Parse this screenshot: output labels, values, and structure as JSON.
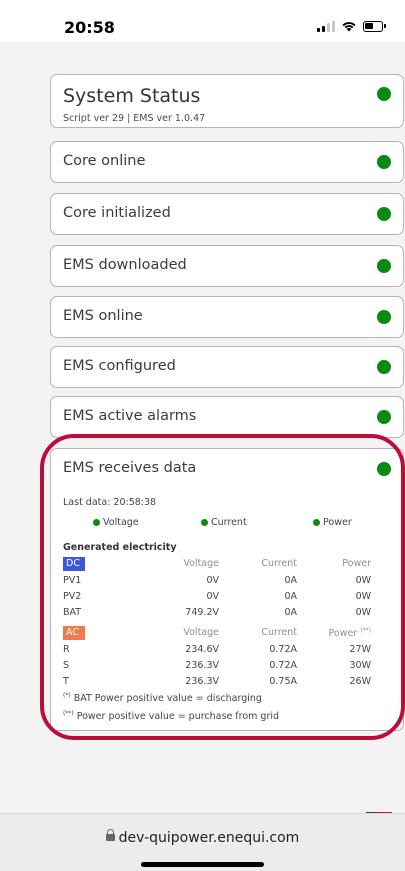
{
  "status_bar": {
    "time": "20:58"
  },
  "system_status": {
    "title": "System Status",
    "subtitle": "Script ver 29 | EMS ver 1.0.47"
  },
  "checks": [
    {
      "label": "Core online"
    },
    {
      "label": "Core initialized"
    },
    {
      "label": "EMS downloaded"
    },
    {
      "label": "EMS online"
    },
    {
      "label": "EMS configured"
    },
    {
      "label": "EMS active alarms"
    }
  ],
  "receives": {
    "title": "EMS receives data",
    "last_data": "Last data: 20:58:38",
    "legend": {
      "voltage": "Voltage",
      "current": "Current",
      "power": "Power"
    },
    "generated_title": "Generated electricity",
    "dc": {
      "tag": "DC",
      "headers": {
        "voltage": "Voltage",
        "current": "Current",
        "power": "Power"
      },
      "rows": [
        {
          "name": "PV1",
          "voltage": "0V",
          "current": "0A",
          "power": "0W"
        },
        {
          "name": "PV2",
          "voltage": "0V",
          "current": "0A",
          "power": "0W"
        },
        {
          "name": "BAT",
          "voltage": "749.2V",
          "current": "0A",
          "power": "0W"
        }
      ]
    },
    "ac": {
      "tag": "AC",
      "headers": {
        "voltage": "Voltage",
        "current": "Current",
        "power": "Power"
      },
      "power_marker": "(**)",
      "rows": [
        {
          "name": "R",
          "voltage": "234.6V",
          "current": "0.72A",
          "power": "27W"
        },
        {
          "name": "S",
          "voltage": "236.3V",
          "current": "0.72A",
          "power": "30W"
        },
        {
          "name": "T",
          "voltage": "236.3V",
          "current": "0.75A",
          "power": "26W"
        }
      ]
    },
    "notes": [
      {
        "marker": "(*)",
        "text": " BAT Power positive value = discharging"
      },
      {
        "marker": "(**)",
        "text": " Power positive value = purchase from grid"
      }
    ]
  },
  "browser": {
    "url": "dev-quipower.enequi.com"
  },
  "colors": {
    "status_ok": "#0b8a12",
    "highlight": "#bf0a3a",
    "dc_tag": "#3d58d6",
    "ac_tag": "#f07a4f"
  }
}
